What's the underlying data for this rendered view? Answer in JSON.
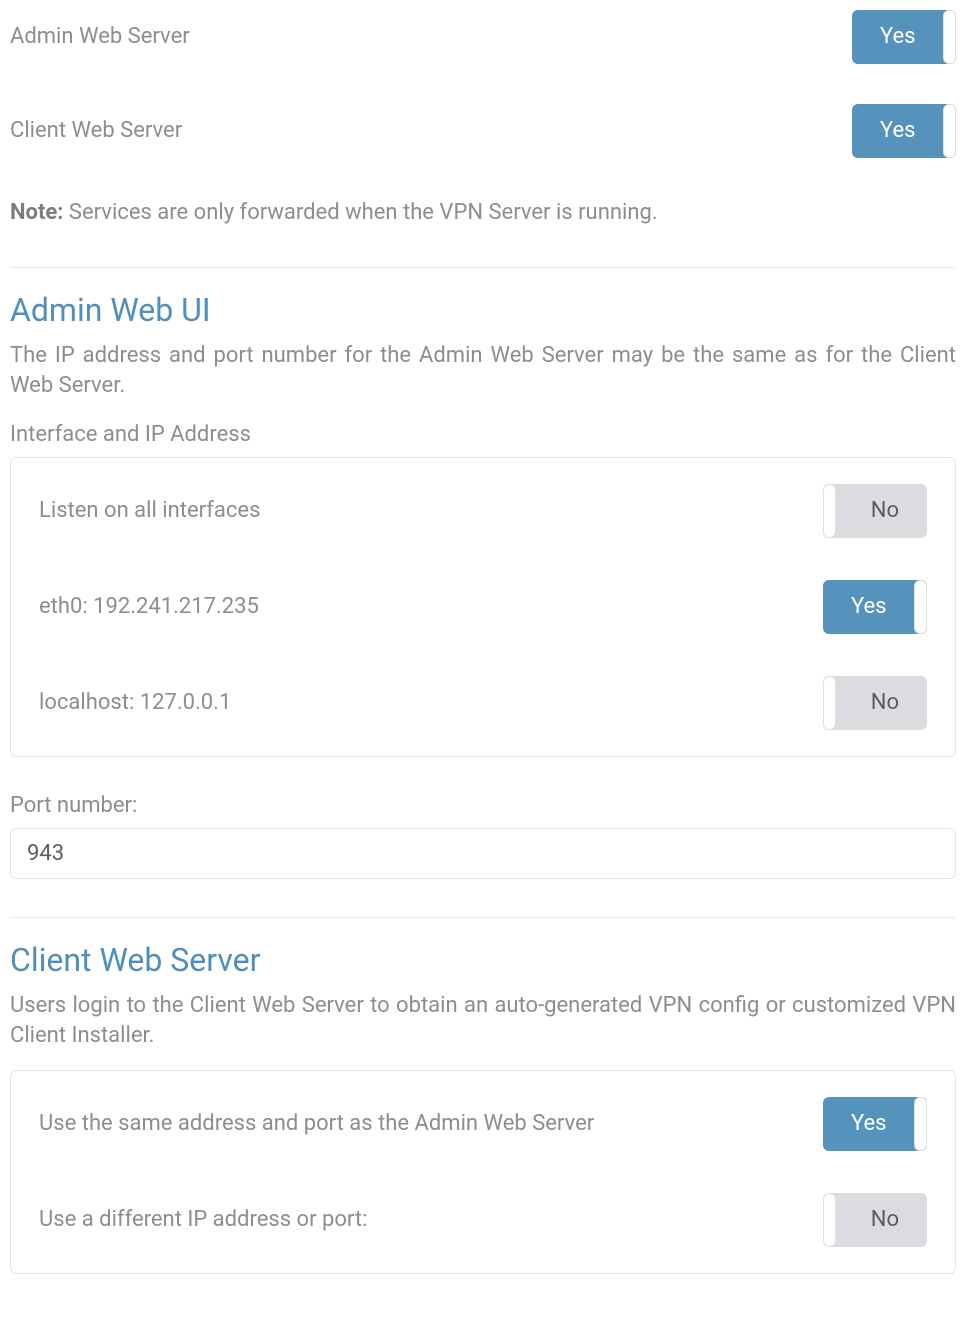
{
  "top_toggles": {
    "admin_web_server": {
      "label": "Admin Web Server",
      "state": "Yes"
    },
    "client_web_server": {
      "label": "Client Web Server",
      "state": "Yes"
    }
  },
  "note": {
    "prefix": "Note:",
    "text": " Services are only forwarded when the VPN Server is running."
  },
  "admin_web_ui": {
    "title": "Admin Web UI",
    "description": "The IP address and port number for the Admin Web Server may be the same as for the Client Web Server.",
    "interface_label": "Interface and IP Address",
    "interfaces": [
      {
        "label": "Listen on all interfaces",
        "state": "No"
      },
      {
        "label": "eth0: 192.241.217.235",
        "state": "Yes"
      },
      {
        "label": "localhost: 127.0.0.1",
        "state": "No"
      }
    ],
    "port_label": "Port number:",
    "port_value": "943"
  },
  "client_web_server": {
    "title": "Client Web Server",
    "description": "Users login to the Client Web Server to obtain an auto-generated VPN config or customized VPN Client Installer.",
    "options": [
      {
        "label": "Use the same address and port as the Admin Web Server",
        "state": "Yes"
      },
      {
        "label": "Use a different IP address or port:",
        "state": "No"
      }
    ]
  }
}
